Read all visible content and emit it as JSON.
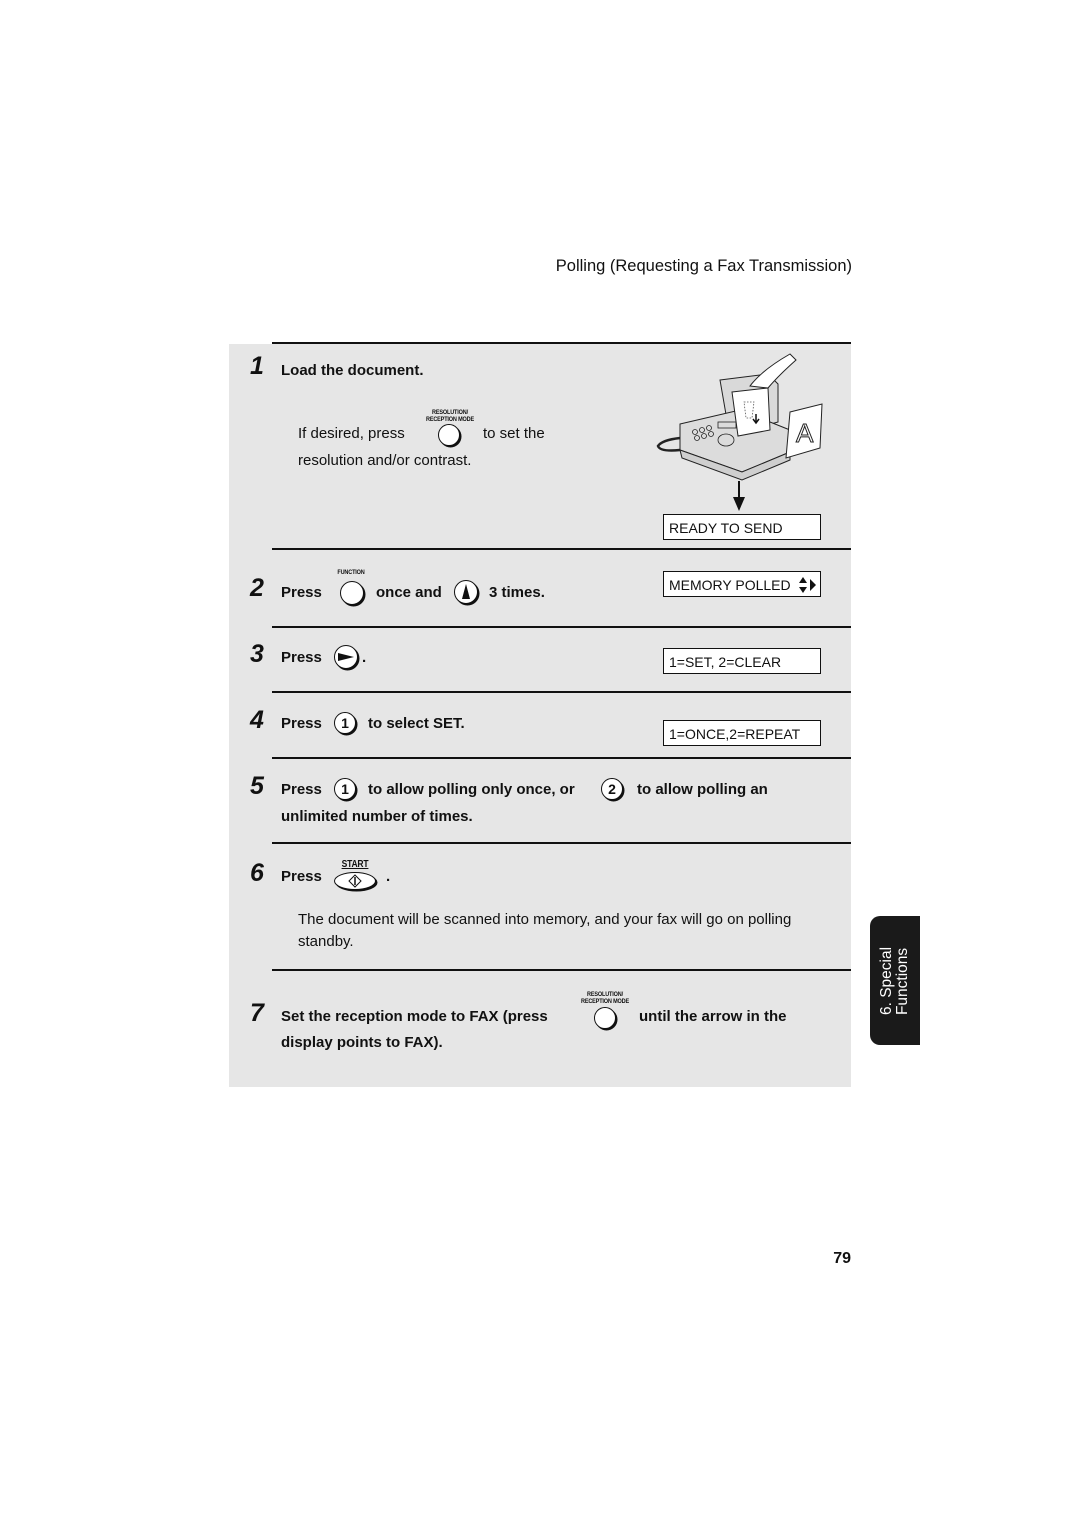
{
  "header": {
    "title": "Polling (Requesting a Fax Transmission)"
  },
  "steps": [
    {
      "number": "1",
      "text": "Load the document.",
      "body_line1_a": "If desired, press",
      "body_line1_b": "to set the",
      "body_line2": "resolution and/or contrast.",
      "key_label_top": "RESOLUTION/",
      "key_label_bottom": "RECEPTION MODE",
      "display": "READY TO SEND"
    },
    {
      "number": "2",
      "text_a": "Press",
      "text_b": "once and",
      "text_c": "3 times.",
      "key_label": "FUNCTION",
      "display": "MEMORY POLLED"
    },
    {
      "number": "3",
      "text_a": "Press",
      "text_b": ".",
      "display": "1=SET, 2=CLEAR"
    },
    {
      "number": "4",
      "text_a": "Press",
      "key": "1",
      "text_b": "to select SET.",
      "display": "1=ONCE,2=REPEAT"
    },
    {
      "number": "5",
      "text_a": "Press",
      "key1": "1",
      "text_b": "to allow polling only once, or",
      "key2": "2",
      "text_c": "to allow polling an",
      "text_d": "unlimited number of times."
    },
    {
      "number": "6",
      "text_a": "Press",
      "text_b": ".",
      "key_label": "START",
      "body_line1": "The document will be scanned into memory, and your fax will go on polling",
      "body_line2": "standby."
    },
    {
      "number": "7",
      "text_a": "Set the reception mode to FAX (press",
      "text_b": "until the arrow in the",
      "text_c": "display points to FAX).",
      "key_label_top": "RESOLUTION/",
      "key_label_bottom": "RECEPTION MODE"
    }
  ],
  "side_tab": {
    "line1": "6. Special",
    "line2": "Functions"
  },
  "page_number": "79",
  "illustration": {
    "paper_letter": "A"
  }
}
